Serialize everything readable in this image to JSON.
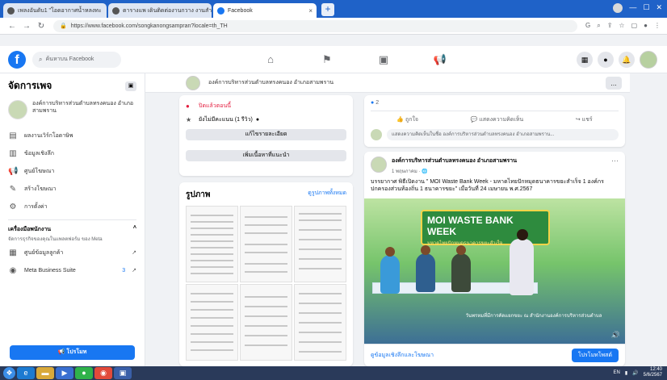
{
  "browser": {
    "tabs": [
      {
        "label": "เพลงอันดับ1 \"โอดอากาศน้ำหลงทะ"
      },
      {
        "label": "ตารางแพ เดินติดต่องานกวาง งานสำนักงาน"
      },
      {
        "label": "Facebook"
      }
    ],
    "url": "https://www.facebook.com/songkanongsampran?locale=th_TH"
  },
  "facebook": {
    "logo": "f",
    "search_placeholder": "ค้นหาบน Facebook",
    "nav_icons": [
      "home-icon",
      "flag-icon",
      "video-icon",
      "megaphone-icon"
    ]
  },
  "sidebar": {
    "title": "จัดการเพจ",
    "page_name": "องค์การบริหารส่วนตำบลทรงคนอง อำเภอสามพราน",
    "items": [
      {
        "label": "ผลงานเวิร์กโอดาษิพ",
        "icon": "dashboard-icon"
      },
      {
        "label": "ข้อมูลเชิงลึก",
        "icon": "insights-icon"
      },
      {
        "label": "ศูนย์โฆษณา",
        "icon": "megaphone-icon"
      },
      {
        "label": "สร้างโฆษณา",
        "icon": "edit-icon"
      },
      {
        "label": "การตั้งค่า",
        "icon": "gear-icon"
      }
    ],
    "tools_title": "เครื่องมือพนักงาน",
    "tools_sub": "จัดการธุรกิจของคุณในแพลตฟอร์ม ของ Meta",
    "tool_items": [
      {
        "label": "ศูนย์ข้อมูลลูกค้า",
        "badge": ""
      },
      {
        "label": "Meta Business Suite",
        "badge": "3"
      }
    ],
    "promote_label": "โปรโมท"
  },
  "page_header": {
    "name": "องค์การบริหารส่วนตำบลทรงคนอง อำเภอสามพราน",
    "more": "..."
  },
  "intro": {
    "status": "ปิดแล้วตอนนี้",
    "rating": "ยังไม่มีคะแนน (1 รีวิว)",
    "btn1": "แก้ไขรายละเอียด",
    "btn2": "เพิ่มเนื้อหาที่แนะนำ"
  },
  "photos": {
    "title": "รูปภาพ",
    "link": "ดูรูปภาพทั้งหมด"
  },
  "post1": {
    "reactions": "2",
    "like": "ถูกใจ",
    "comment": "แสดงความคิดเห็น",
    "share": "แชร์",
    "comment_placeholder": "แสดงความคิดเห็นในชื่อ องค์การบริหารส่วนตำบลทรงคนอง อำเภอสามพราน..."
  },
  "post2": {
    "author": "องค์การบริหารส่วนตำบลทรงคนอง อำเภอสามพราน",
    "time": "1 พฤษภาคม",
    "body": "บรรยากาศ พิธีเปิดงาน \" MOI Waste Bank Week - มหาดไทยปักหมุดธนาคารขยะสำเร็จ 1 องค์กรปกครองส่วนท้องถิ่น 1 ธนาคารขยะ\" เมื่อวันที่ 24 เมษายน พ.ศ.2567",
    "banner_title": "MOI WASTE BANK WEEK",
    "banner_sub": "มหาดไทยปักหมุดธนาคารขยะสำเร็จ",
    "image_caption": "วันพรหมที่มีการคัดแยกขยะ ณ สำนักงานองค์การบริหารส่วนตำบล",
    "insights_link": "ดูข้อมูลเชิงลึกและโฆษณา",
    "boost": "โปรโมทโพสต์"
  },
  "taskbar": {
    "lang": "EN",
    "time": "12:40",
    "date": "5/6/2567"
  }
}
